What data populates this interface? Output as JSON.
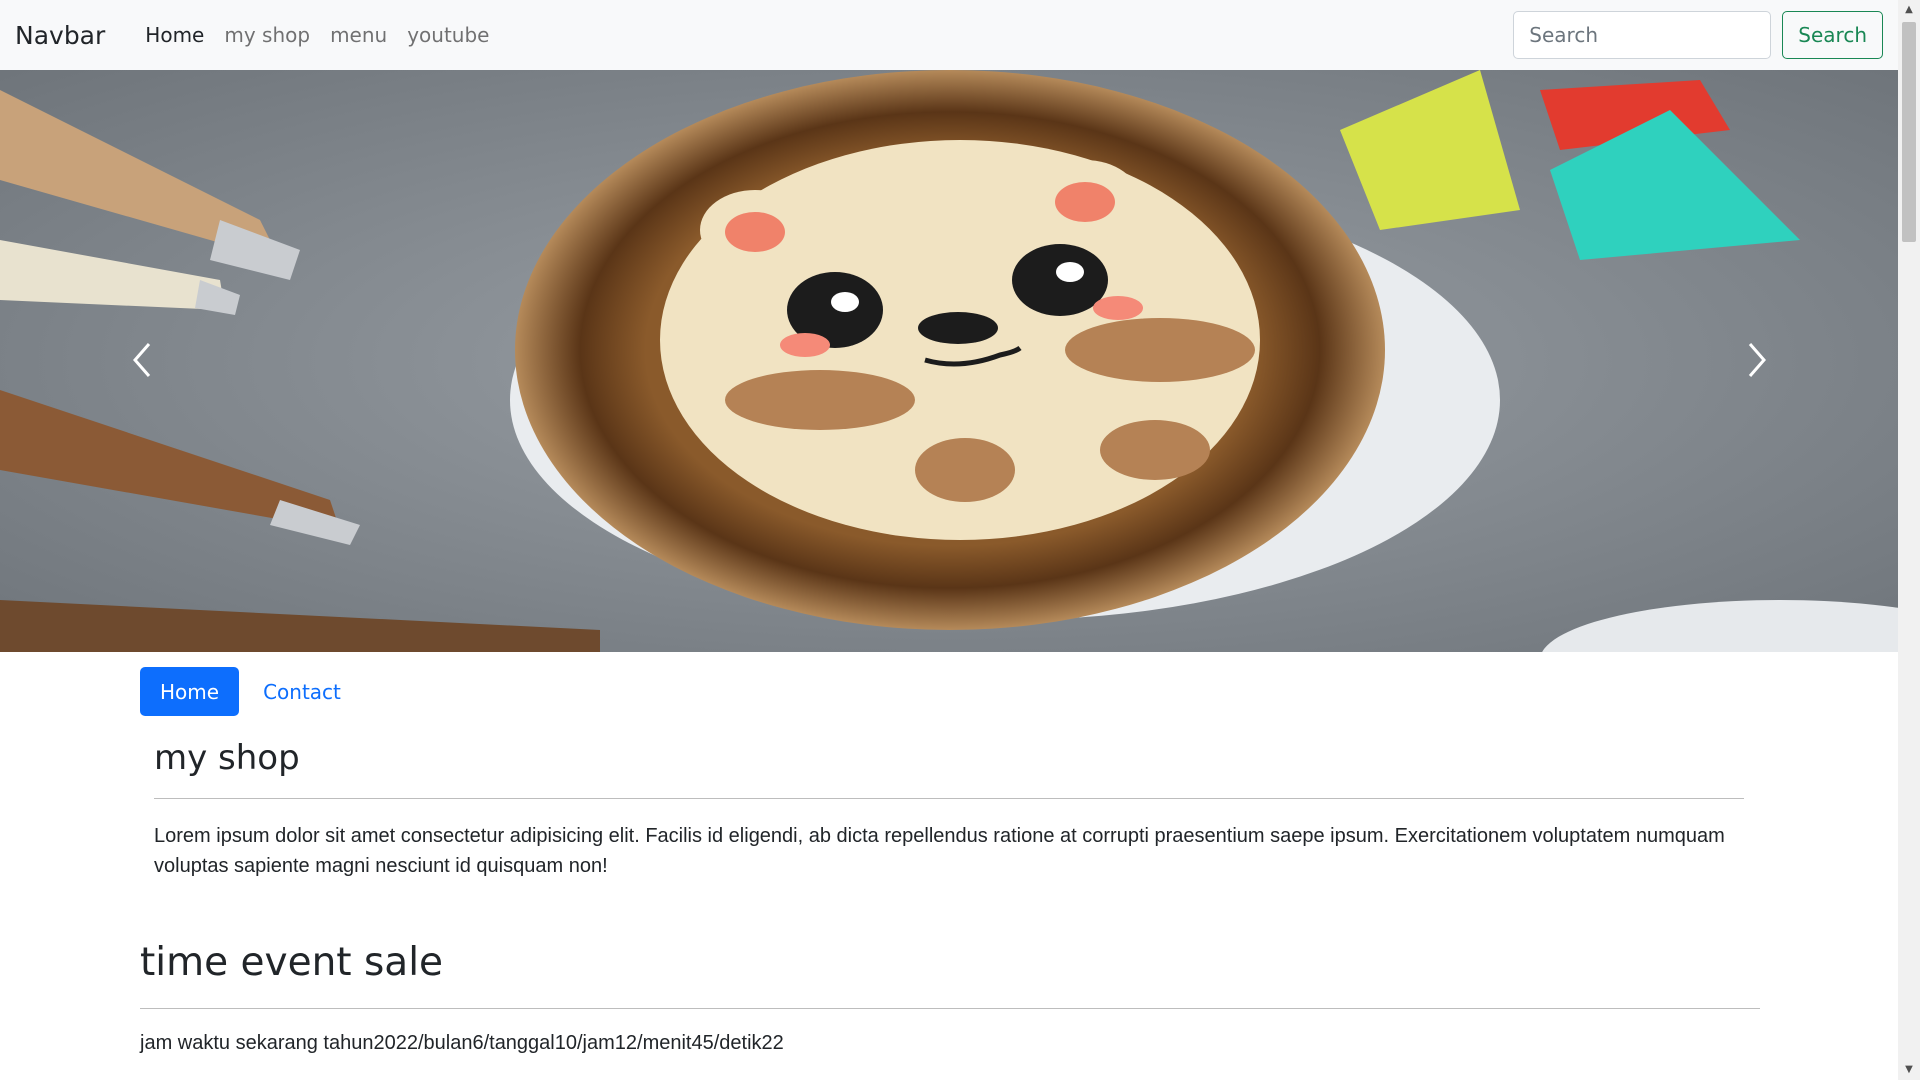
{
  "navbar": {
    "brand": "Navbar",
    "links": [
      {
        "label": "Home",
        "active": true
      },
      {
        "label": "my shop",
        "active": false
      },
      {
        "label": "menu",
        "active": false
      },
      {
        "label": "youtube",
        "active": false
      }
    ],
    "search": {
      "placeholder": "Search",
      "button_label": "Search",
      "button_color": "#198754"
    }
  },
  "carousel": {
    "prev_icon": "chevron-left-icon",
    "next_icon": "chevron-right-icon"
  },
  "pills": [
    {
      "label": "Home",
      "active": true,
      "color": "#0d6efd"
    },
    {
      "label": "Contact",
      "active": false
    }
  ],
  "shop": {
    "title": "my shop",
    "description": "Lorem ipsum dolor sit amet consectetur adipisicing elit. Facilis id eligendi, ab dicta repellendus ratione at corrupti praesentium saepe ipsum. Exercitationem voluptatem numquam voluptas sapiente magni nesciunt id quisquam non!"
  },
  "event": {
    "title": "time event sale",
    "time_text": "jam waktu sekarang tahun2022/bulan6/tanggal10/jam12/menit45/detik22"
  }
}
